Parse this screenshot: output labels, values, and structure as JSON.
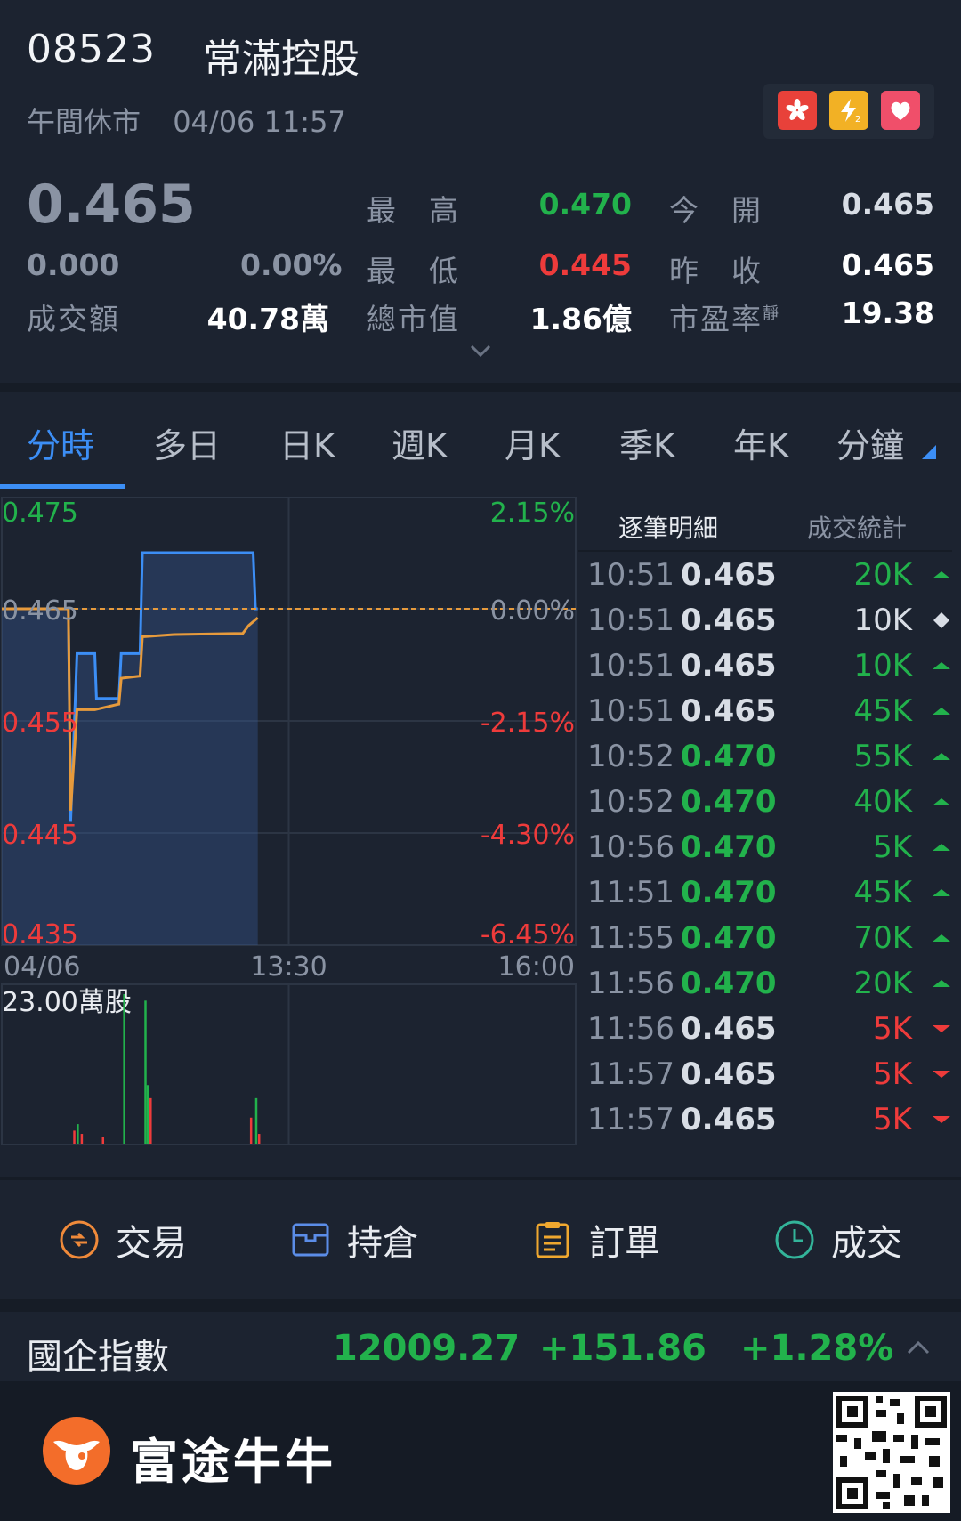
{
  "stock": {
    "code": "08523",
    "name": "常滿控股",
    "status": "午間休市",
    "datetime": "04/06 11:57",
    "price": "0.465",
    "change": "0.000",
    "change_pct": "0.00%",
    "turnover_label": "成交額",
    "turnover": "40.78萬",
    "high_label": "最　高",
    "high": "0.470",
    "open_label": "今　開",
    "open": "0.465",
    "low_label": "最　低",
    "low": "0.445",
    "prev_close_label": "昨　收",
    "prev_close": "0.465",
    "mktcap_label": "總市值",
    "mktcap": "1.86億",
    "pe_label": "市盈率",
    "pe_sup": "靜",
    "pe": "19.38"
  },
  "badges": [
    "hk-flag-icon",
    "lightning-l2-icon",
    "heart-icon"
  ],
  "tabs": [
    "分時",
    "多日",
    "日K",
    "週K",
    "月K",
    "季K",
    "年K",
    "分鐘"
  ],
  "chart_data": {
    "type": "line",
    "y_left_ticks": [
      "0.475",
      "0.465",
      "0.455",
      "0.445",
      "0.435"
    ],
    "y_right_ticks": [
      "2.15%",
      "0.00%",
      "-2.15%",
      "-4.30%",
      "-6.45%"
    ],
    "ylim": [
      0.435,
      0.475
    ],
    "x_ticks": [
      "04/06",
      "13:30",
      "16:00"
    ],
    "prev_close": 0.465,
    "series": [
      {
        "values": [
          [
            0,
            0.465
          ],
          [
            0.116,
            0.465
          ],
          [
            0.12,
            0.446
          ],
          [
            0.131,
            0.461
          ],
          [
            0.162,
            0.461
          ],
          [
            0.165,
            0.457
          ],
          [
            0.204,
            0.457
          ],
          [
            0.208,
            0.461
          ],
          [
            0.241,
            0.461
          ],
          [
            0.245,
            0.47
          ],
          [
            0.438,
            0.47
          ],
          [
            0.442,
            0.465
          ],
          [
            0.446,
            0.465
          ]
        ]
      },
      {
        "values": [
          [
            0,
            0.465
          ],
          [
            0.116,
            0.465
          ],
          [
            0.12,
            0.447
          ],
          [
            0.131,
            0.456
          ],
          [
            0.162,
            0.456
          ],
          [
            0.204,
            0.4565
          ],
          [
            0.208,
            0.4588
          ],
          [
            0.241,
            0.459
          ],
          [
            0.245,
            0.4625
          ],
          [
            0.3,
            0.4627
          ],
          [
            0.42,
            0.4628
          ],
          [
            0.43,
            0.4635
          ],
          [
            0.446,
            0.4642
          ]
        ]
      }
    ],
    "volume_label": "23.00萬股",
    "volume_max": 230000,
    "volume": [
      {
        "t": 0.126,
        "v": 20000,
        "c": "red"
      },
      {
        "t": 0.132,
        "v": 30000,
        "c": "green"
      },
      {
        "t": 0.139,
        "v": 15000,
        "c": "red"
      },
      {
        "t": 0.176,
        "v": 10000,
        "c": "red"
      },
      {
        "t": 0.213,
        "v": 230000,
        "c": "green"
      },
      {
        "t": 0.25,
        "v": 220000,
        "c": "green"
      },
      {
        "t": 0.254,
        "v": 90000,
        "c": "green"
      },
      {
        "t": 0.259,
        "v": 70000,
        "c": "red"
      },
      {
        "t": 0.434,
        "v": 40000,
        "c": "red"
      },
      {
        "t": 0.443,
        "v": 70000,
        "c": "green"
      },
      {
        "t": 0.448,
        "v": 15000,
        "c": "red"
      }
    ]
  },
  "trades_tabs": [
    "逐筆明細",
    "成交統計"
  ],
  "trades": [
    {
      "time": "10:51",
      "price": "0.465",
      "vol": "20K",
      "dir": "up"
    },
    {
      "time": "10:51",
      "price": "0.465",
      "vol": "10K",
      "dir": "neutral"
    },
    {
      "time": "10:51",
      "price": "0.465",
      "vol": "10K",
      "dir": "up"
    },
    {
      "time": "10:51",
      "price": "0.465",
      "vol": "45K",
      "dir": "up"
    },
    {
      "time": "10:52",
      "price": "0.470",
      "vol": "55K",
      "dir": "up"
    },
    {
      "time": "10:52",
      "price": "0.470",
      "vol": "40K",
      "dir": "up"
    },
    {
      "time": "10:56",
      "price": "0.470",
      "vol": "5K",
      "dir": "up"
    },
    {
      "time": "11:51",
      "price": "0.470",
      "vol": "45K",
      "dir": "up"
    },
    {
      "time": "11:55",
      "price": "0.470",
      "vol": "70K",
      "dir": "up"
    },
    {
      "time": "11:56",
      "price": "0.470",
      "vol": "20K",
      "dir": "up"
    },
    {
      "time": "11:56",
      "price": "0.465",
      "vol": "5K",
      "dir": "down"
    },
    {
      "time": "11:57",
      "price": "0.465",
      "vol": "5K",
      "dir": "down"
    },
    {
      "time": "11:57",
      "price": "0.465",
      "vol": "5K",
      "dir": "down"
    }
  ],
  "actions": [
    "交易",
    "持倉",
    "訂單",
    "成交"
  ],
  "index": {
    "name": "國企指數",
    "value": "12009.27",
    "change": "+151.86",
    "change_pct": "+1.28%"
  },
  "footer": {
    "brand": "富途牛牛"
  },
  "colors": {
    "up": "#22b24c",
    "down": "#ee3b3b",
    "accent": "#3c8ef5",
    "avg_line": "#e69a3c"
  }
}
